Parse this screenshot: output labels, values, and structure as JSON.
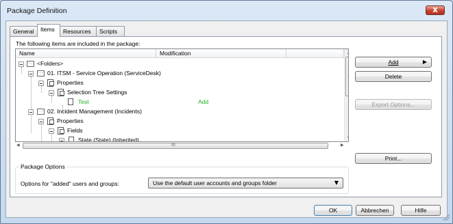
{
  "window": {
    "title": "Package Definition",
    "close_glyph": "x"
  },
  "tabs": [
    {
      "label": "General",
      "active": false
    },
    {
      "label": "Items",
      "active": true
    },
    {
      "label": "Resources",
      "active": false
    },
    {
      "label": "Scripts",
      "active": false
    }
  ],
  "items_panel": {
    "intro": "The following items are included in the package:",
    "columns": [
      "Name",
      "Modification"
    ],
    "tree_rows": [
      {
        "label": "<Folders>",
        "modification": "",
        "icon": "folder-icon",
        "expanded": true,
        "highlight": false
      },
      {
        "label": "01. ITSM - Service Operation (ServiceDesk)",
        "modification": "",
        "icon": "folder-icon",
        "expanded": true,
        "highlight": false
      },
      {
        "label": "Properties",
        "modification": "",
        "icon": "document-icon",
        "expanded": true,
        "highlight": false
      },
      {
        "label": "Selection Tree Settings",
        "modification": "",
        "icon": "document-icon",
        "expanded": true,
        "highlight": false
      },
      {
        "label": "Test",
        "modification": "Add",
        "icon": "page-icon",
        "expanded": null,
        "highlight": true
      },
      {
        "label": "02. Incident Management (Incidents)",
        "modification": "",
        "icon": "folder-icon",
        "expanded": true,
        "highlight": false
      },
      {
        "label": "Properties",
        "modification": "",
        "icon": "document-icon",
        "expanded": true,
        "highlight": false
      },
      {
        "label": "Fields",
        "modification": "",
        "icon": "document-icon",
        "expanded": true,
        "highlight": false
      },
      {
        "label": "State (State) (Inherited)",
        "modification": "",
        "icon": "page-icon",
        "expanded": true,
        "highlight": false
      }
    ],
    "hscroll_thumb_glyph": "III",
    "vscroll_thumb_glyph": "≡",
    "buttons": {
      "add": "Add",
      "delete": "Delete",
      "export_options": "Export Options...",
      "print": "Print..."
    },
    "package_options": {
      "group_label": "Package Options",
      "added_users_label": "Options for \"added\" users and groups:",
      "added_users_value": "Use the default user accounts and groups folder"
    }
  },
  "footer_buttons": {
    "ok": "OK",
    "cancel": "Abbrechen",
    "help": "Hilfe"
  },
  "colors": {
    "highlight_text": "#20b020",
    "accent_border": "#3c7fb1",
    "close_red": "#c7412f"
  }
}
